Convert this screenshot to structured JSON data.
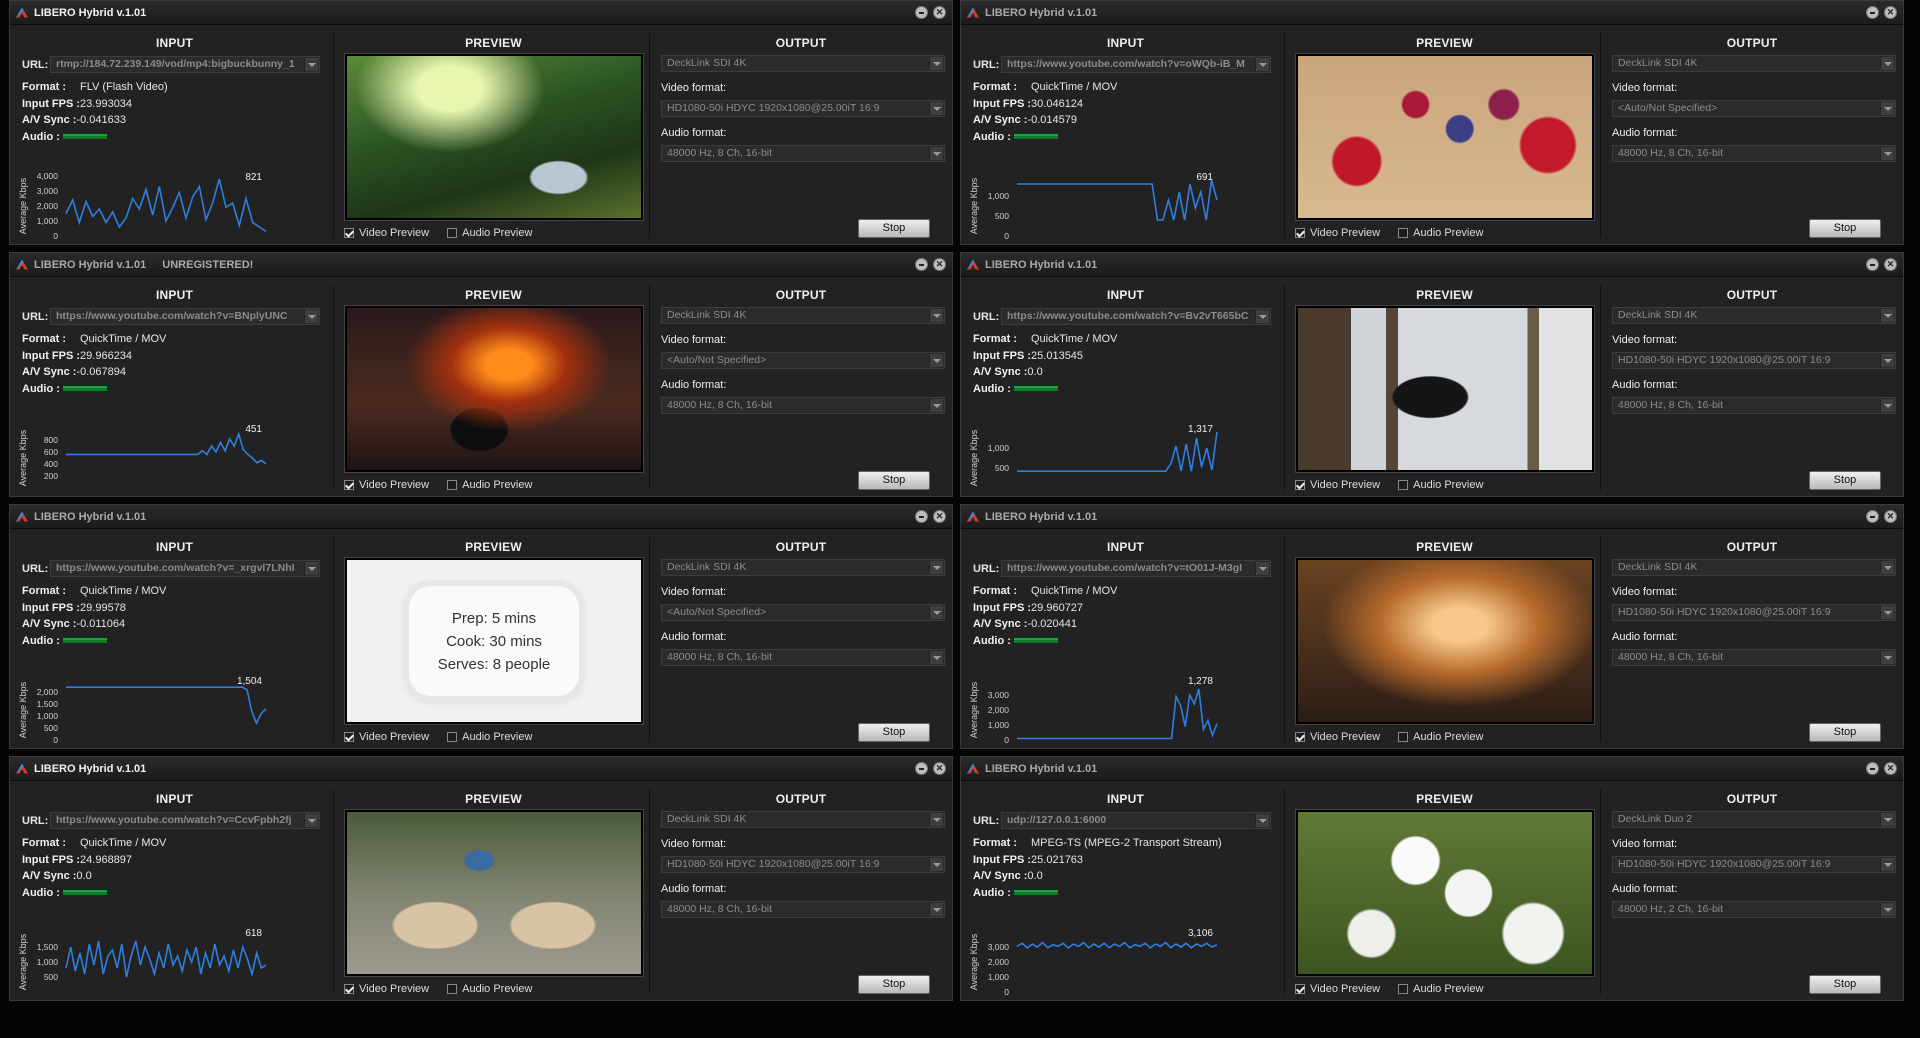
{
  "app_title": "LIBERO Hybrid v.1.01",
  "unregistered_label": "UNREGISTERED!",
  "labels": {
    "input": "INPUT",
    "preview": "PREVIEW",
    "output": "OUTPUT",
    "url": "URL:",
    "format": "Format :",
    "input_fps": "Input FPS :",
    "av_sync": "A/V Sync :",
    "audio": "Audio :",
    "video_preview": "Video Preview",
    "audio_preview": "Audio Preview",
    "video_format": "Video format:",
    "audio_format": "Audio format:",
    "stop": "Stop",
    "y_axis": "Average Kbps"
  },
  "colors": {
    "chart_line": "#2f7fe0",
    "audio_meter": "#18a83a"
  },
  "windows": [
    {
      "id": 0,
      "active": true,
      "unregistered": false,
      "url": "rtmp://184.72.239.149/vod/mp4:bigbuckbunny_1",
      "format": "FLV (Flash Video)",
      "fps": "23.993034",
      "sync": "-0.041633",
      "scene": "s0",
      "video_preview": true,
      "audio_preview": false,
      "device": "DeckLink SDI 4K",
      "video_format": "HD1080-50i HDYC 1920x1080@25.00iT 16:9",
      "audio_format": "48000 Hz, 8 Ch, 16-bit",
      "chart_data": {
        "type": "line",
        "ylim": [
          0,
          4000
        ],
        "yticks": [
          "4,000",
          "3,000",
          "2,000",
          "1,000",
          "0"
        ],
        "yvals": [
          4000,
          3000,
          2000,
          1000,
          0
        ],
        "peak_label": "821",
        "values": [
          1500,
          2400,
          900,
          2300,
          1300,
          1800,
          900,
          1600,
          600,
          1200,
          2500,
          1800,
          3100,
          1400,
          3300,
          1000,
          1900,
          2900,
          1200,
          2600,
          3300,
          1100,
          2200,
          3800,
          1900,
          2200,
          700,
          2500,
          900,
          600,
          300
        ]
      }
    },
    {
      "id": 1,
      "active": false,
      "unregistered": false,
      "url": "https://www.youtube.com/watch?v=oWQb-iB_M",
      "format": "QuickTime / MOV",
      "fps": "30.046124",
      "sync": "-0.014579",
      "scene": "s1",
      "video_preview": true,
      "audio_preview": false,
      "device": "DeckLink SDI 4K",
      "video_format": "<Auto/Not Specified>",
      "audio_format": "48000 Hz, 8 Ch, 16-bit",
      "chart_data": {
        "type": "line",
        "ylim": [
          0,
          1500
        ],
        "yticks": [
          "1,000",
          "500",
          "0"
        ],
        "yvals": [
          1000,
          500,
          0
        ],
        "peak_label": "691",
        "values": [
          1300,
          1300,
          1300,
          1300,
          1300,
          1300,
          1300,
          1300,
          1300,
          1300,
          1300,
          1300,
          1300,
          1300,
          1300,
          1300,
          1300,
          1300,
          1300,
          1300,
          1300,
          1300,
          1300,
          1300,
          1300,
          1300,
          400,
          400,
          900,
          400,
          1100,
          400,
          1300,
          700,
          1100,
          400,
          1400,
          900
        ]
      }
    },
    {
      "id": 2,
      "active": false,
      "unregistered": true,
      "url": "https://www.youtube.com/watch?v=BNplyUNC",
      "format": "QuickTime / MOV",
      "fps": "29.966234",
      "sync": "-0.067894",
      "scene": "s2",
      "video_preview": true,
      "audio_preview": false,
      "device": "DeckLink SDI 4K",
      "video_format": "<Auto/Not Specified>",
      "audio_format": "48000 Hz, 8 Ch, 16-bit",
      "chart_data": {
        "type": "line",
        "ylim": [
          0,
          1000
        ],
        "yticks": [
          "800",
          "600",
          "400",
          "200"
        ],
        "yvals": [
          800,
          600,
          400,
          200
        ],
        "peak_label": "451",
        "values": [
          560,
          560,
          560,
          560,
          560,
          560,
          560,
          560,
          560,
          560,
          560,
          560,
          560,
          560,
          560,
          560,
          560,
          560,
          560,
          560,
          560,
          560,
          560,
          560,
          560,
          560,
          560,
          560,
          560,
          560,
          620,
          560,
          700,
          600,
          760,
          620,
          820,
          700,
          900,
          640,
          560,
          500,
          420,
          460,
          400
        ]
      }
    },
    {
      "id": 3,
      "active": false,
      "unregistered": false,
      "url": "https://www.youtube.com/watch?v=Bv2vT665bC",
      "format": "QuickTime / MOV",
      "fps": "25.013545",
      "sync": "0.0",
      "scene": "s3",
      "video_preview": true,
      "audio_preview": false,
      "device": "DeckLink SDI 4K",
      "video_format": "HD1080-50i HDYC 1920x1080@25.00iT 16:9",
      "audio_format": "48000 Hz, 8 Ch, 16-bit",
      "chart_data": {
        "type": "line",
        "ylim": [
          0,
          1500
        ],
        "yticks": [
          "1,000",
          "500"
        ],
        "yvals": [
          1000,
          500
        ],
        "peak_label": "1,317",
        "values": [
          420,
          420,
          420,
          420,
          420,
          420,
          420,
          420,
          420,
          420,
          420,
          420,
          420,
          420,
          420,
          420,
          420,
          420,
          420,
          420,
          420,
          420,
          420,
          420,
          420,
          420,
          420,
          420,
          420,
          420,
          600,
          1050,
          430,
          1100,
          420,
          1250,
          520,
          1000,
          450,
          1400
        ]
      }
    },
    {
      "id": 4,
      "active": false,
      "unregistered": false,
      "url": "https://www.youtube.com/watch?v=_xrgvl7LNhI",
      "format": "QuickTime / MOV",
      "fps": "29.99578",
      "sync": "-0.011064",
      "scene": "s4",
      "video_preview": true,
      "audio_preview": false,
      "device": "DeckLink SDI 4K",
      "video_format": "<Auto/Not Specified>",
      "audio_format": "48000 Hz, 8 Ch, 16-bit",
      "preview_text": [
        "Prep: 5 mins",
        "Cook: 30 mins",
        "Serves: 8 people"
      ],
      "chart_data": {
        "type": "line",
        "ylim": [
          0,
          2500
        ],
        "yticks": [
          "2,000",
          "1,500",
          "1,000",
          "500",
          "0"
        ],
        "yvals": [
          2000,
          1500,
          1000,
          500,
          0
        ],
        "peak_label": "1,504",
        "values": [
          2200,
          2200,
          2200,
          2200,
          2200,
          2200,
          2200,
          2200,
          2200,
          2200,
          2200,
          2200,
          2200,
          2200,
          2200,
          2200,
          2200,
          2200,
          2200,
          2200,
          2200,
          2200,
          2200,
          2200,
          2200,
          2200,
          2200,
          2200,
          2200,
          2200,
          2200,
          2200,
          2200,
          2200,
          2200,
          2200,
          2200,
          2200,
          2100,
          1200,
          700,
          1100,
          1300
        ]
      }
    },
    {
      "id": 5,
      "active": false,
      "unregistered": false,
      "url": "https://www.youtube.com/watch?v=tO01J-M3gI",
      "format": "QuickTime / MOV",
      "fps": "29.960727",
      "sync": "-0.020441",
      "scene": "s5",
      "video_preview": true,
      "audio_preview": false,
      "device": "DeckLink SDI 4K",
      "video_format": "HD1080-50i HDYC 1920x1080@25.00iT 16:9",
      "audio_format": "48000 Hz, 8 Ch, 16-bit",
      "chart_data": {
        "type": "line",
        "ylim": [
          0,
          4000
        ],
        "yticks": [
          "3,000",
          "2,000",
          "1,000",
          "0"
        ],
        "yvals": [
          3000,
          2000,
          1000,
          0
        ],
        "peak_label": "1,278",
        "values": [
          100,
          100,
          100,
          100,
          100,
          100,
          100,
          100,
          100,
          100,
          100,
          100,
          100,
          100,
          100,
          100,
          100,
          100,
          100,
          100,
          100,
          100,
          100,
          100,
          100,
          100,
          100,
          100,
          100,
          100,
          100,
          100,
          100,
          100,
          100,
          2900,
          2300,
          900,
          3000,
          2400,
          3400,
          700,
          1300,
          300,
          1100
        ]
      }
    },
    {
      "id": 6,
      "active": true,
      "unregistered": false,
      "url": "https://www.youtube.com/watch?v=CcvFpbh2fj",
      "format": "QuickTime / MOV",
      "fps": "24.968897",
      "sync": "0.0",
      "scene": "s6",
      "video_preview": true,
      "audio_preview": false,
      "device": "DeckLink SDI 4K",
      "video_format": "HD1080-50i HDYC 1920x1080@25.00iT 16:9",
      "audio_format": "48000 Hz, 8 Ch, 16-bit",
      "chart_data": {
        "type": "line",
        "ylim": [
          0,
          2000
        ],
        "yticks": [
          "1,500",
          "1,000",
          "500"
        ],
        "yvals": [
          1500,
          1000,
          500
        ],
        "peak_label": "618",
        "values": [
          800,
          1500,
          700,
          1300,
          600,
          1600,
          900,
          1700,
          600,
          1200,
          1400,
          800,
          1600,
          500,
          1200,
          1700,
          900,
          1500,
          1100,
          600,
          1300,
          800,
          1600,
          900,
          1200,
          700,
          1400,
          1000,
          1500,
          600,
          1300,
          800,
          1600,
          900,
          1200,
          700,
          1400,
          800,
          1500,
          1100,
          600,
          1300,
          800,
          900
        ]
      }
    },
    {
      "id": 7,
      "active": false,
      "unregistered": false,
      "url": "udp://127.0.0.1:6000",
      "format": "MPEG-TS (MPEG-2 Transport Stream)",
      "fps": "25.021763",
      "sync": "0.0",
      "scene": "s7",
      "video_preview": true,
      "audio_preview": false,
      "device": "DeckLink Duo 2",
      "video_format": "HD1080-50i HDYC 1920x1080@25.00iT 16:9",
      "audio_format": "48000 Hz, 2 Ch, 16-bit",
      "chart_data": {
        "type": "line",
        "ylim": [
          0,
          4000
        ],
        "yticks": [
          "3,000",
          "2,000",
          "1,000",
          "0"
        ],
        "yvals": [
          3000,
          2000,
          1000,
          0
        ],
        "peak_label": "3,106",
        "values": [
          3050,
          3250,
          2950,
          3200,
          3000,
          3300,
          2950,
          3150,
          3050,
          3250,
          2950,
          3200,
          3050,
          3300,
          2950,
          3200,
          3000,
          3250,
          2950,
          3200,
          3050,
          3300,
          2950,
          3150,
          3050,
          3250,
          2950,
          3200,
          3050,
          3300,
          2950,
          3200,
          3000,
          3250,
          2950,
          3200,
          3050,
          3250,
          3000,
          3150
        ]
      }
    }
  ]
}
